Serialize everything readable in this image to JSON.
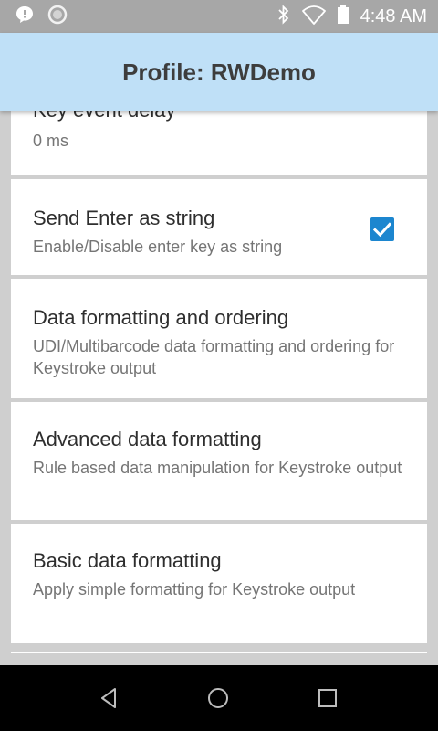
{
  "status_bar": {
    "time": "4:48 AM",
    "left_icons": [
      "chat-bubble-icon",
      "circle-sync-icon"
    ],
    "right_icons": [
      "bluetooth-icon",
      "wifi-icon",
      "battery-icon"
    ]
  },
  "app_bar": {
    "title": "Profile: RWDemo"
  },
  "settings": [
    {
      "title": "Key event delay",
      "summary": "0 ms"
    },
    {
      "title": "Send Enter as string",
      "summary": "Enable/Disable enter key as string",
      "checked": true
    },
    {
      "title": "Data formatting and ordering",
      "summary": "UDI/Multibarcode data formatting and ordering for Keystroke output"
    },
    {
      "title": "Advanced data formatting",
      "summary": "Rule based data manipulation for Keystroke output"
    },
    {
      "title": "Basic data formatting",
      "summary": "Apply simple formatting for Keystroke output"
    }
  ],
  "nav_bar": {
    "buttons": [
      "back-icon",
      "home-icon",
      "recents-icon"
    ]
  },
  "colors": {
    "app_bar_bg": "#bfe0f7",
    "checkbox_accent": "#1c86cf",
    "list_bg": "#cfcfcf",
    "status_bar_bg": "#a7a7a7"
  }
}
